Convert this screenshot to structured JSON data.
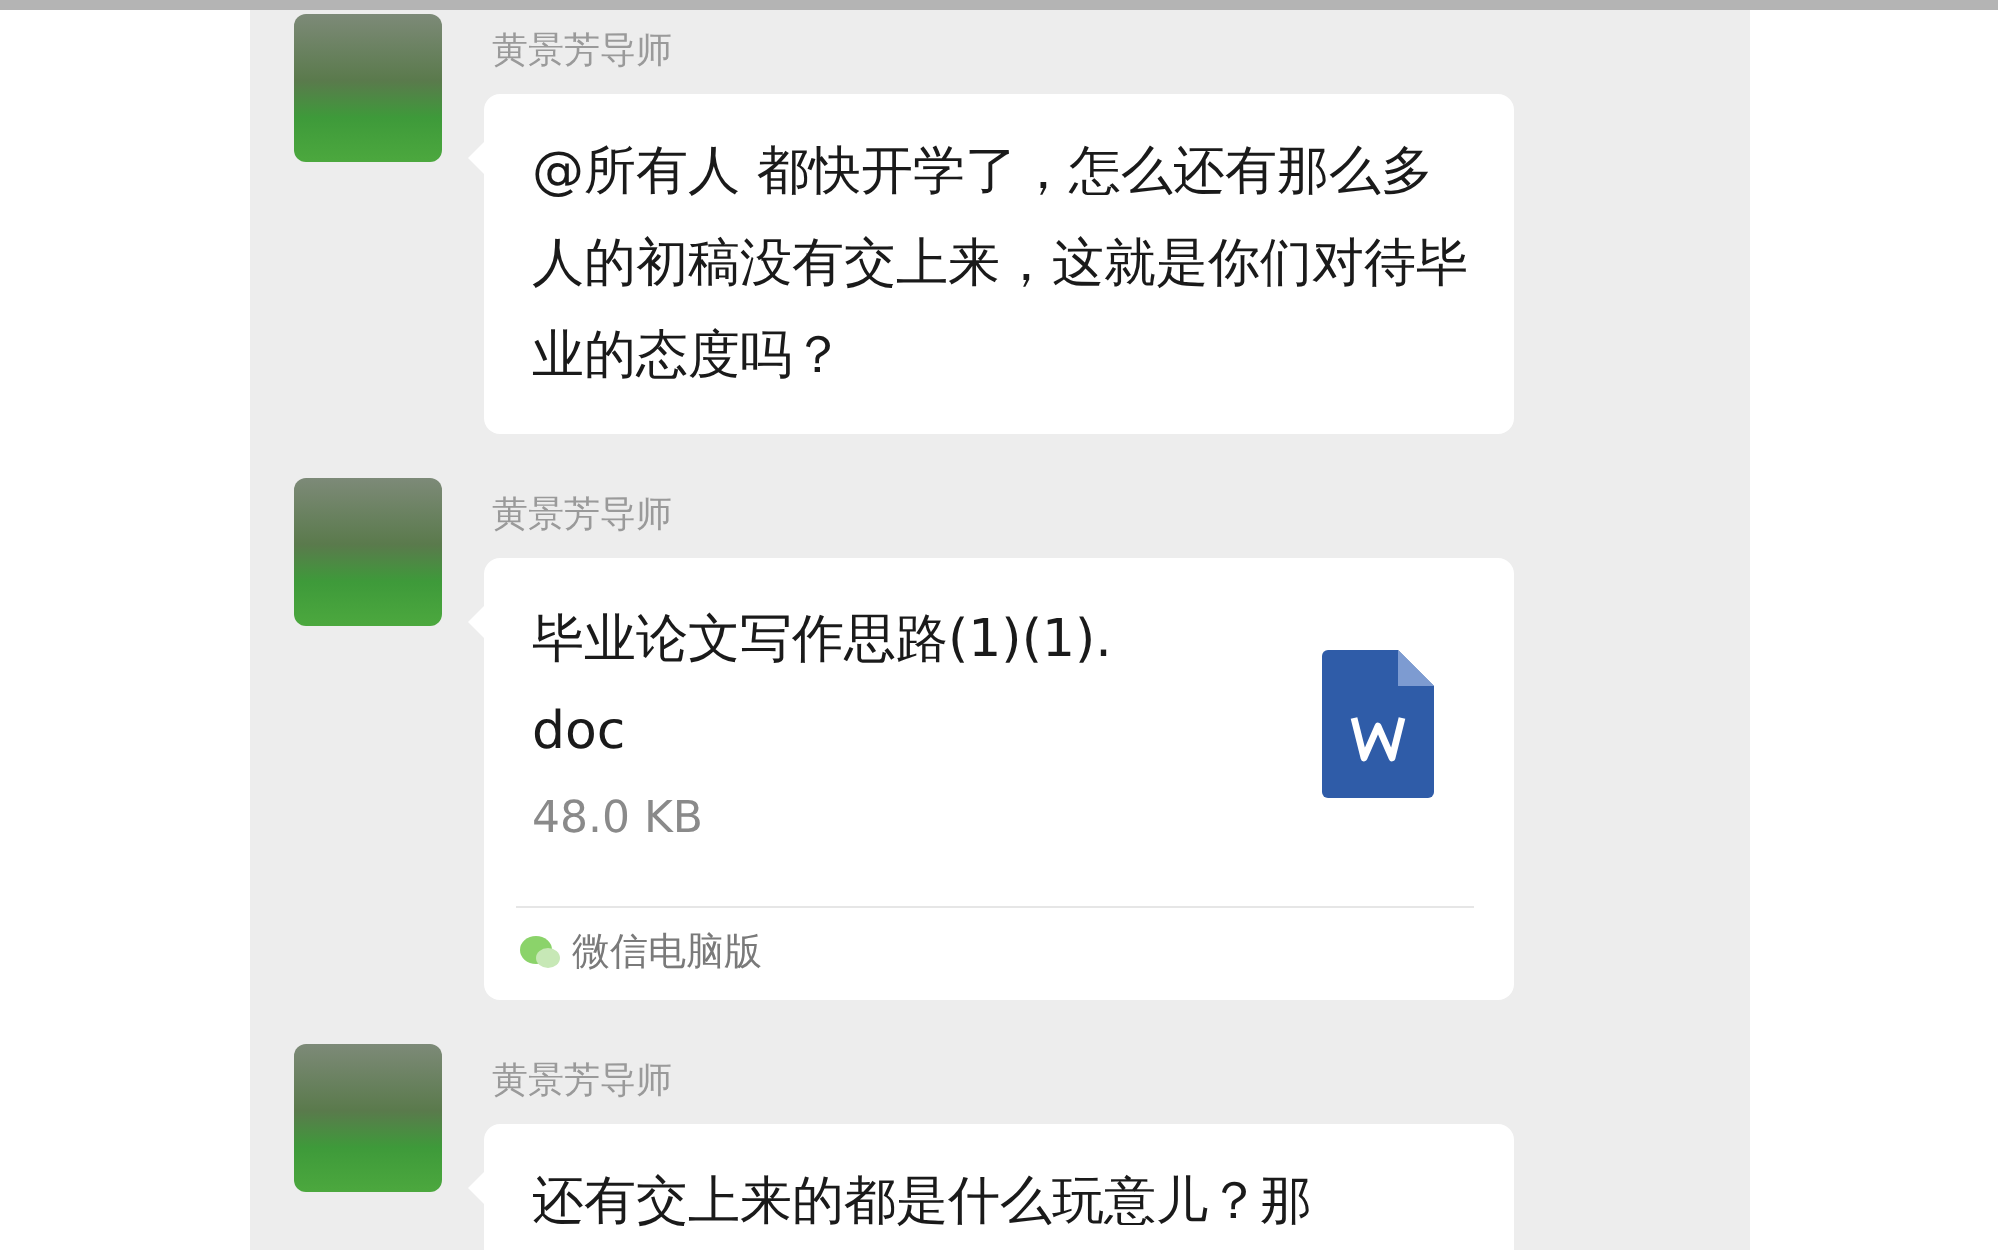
{
  "messages": [
    {
      "kind": "text",
      "sender": "黄景芳导师",
      "text": "@所有人 都快开学了，怎么还有那么多人的初稿没有交上来，这就是你们对待毕业的态度吗？"
    },
    {
      "kind": "file",
      "sender": "黄景芳导师",
      "file_name": "毕业论文写作思路(1)(1).doc",
      "file_size": "48.0 KB",
      "source": "微信电脑版"
    },
    {
      "kind": "text",
      "sender": "黄景芳导师",
      "text": "还有交上来的都是什么玩意儿？那"
    }
  ]
}
